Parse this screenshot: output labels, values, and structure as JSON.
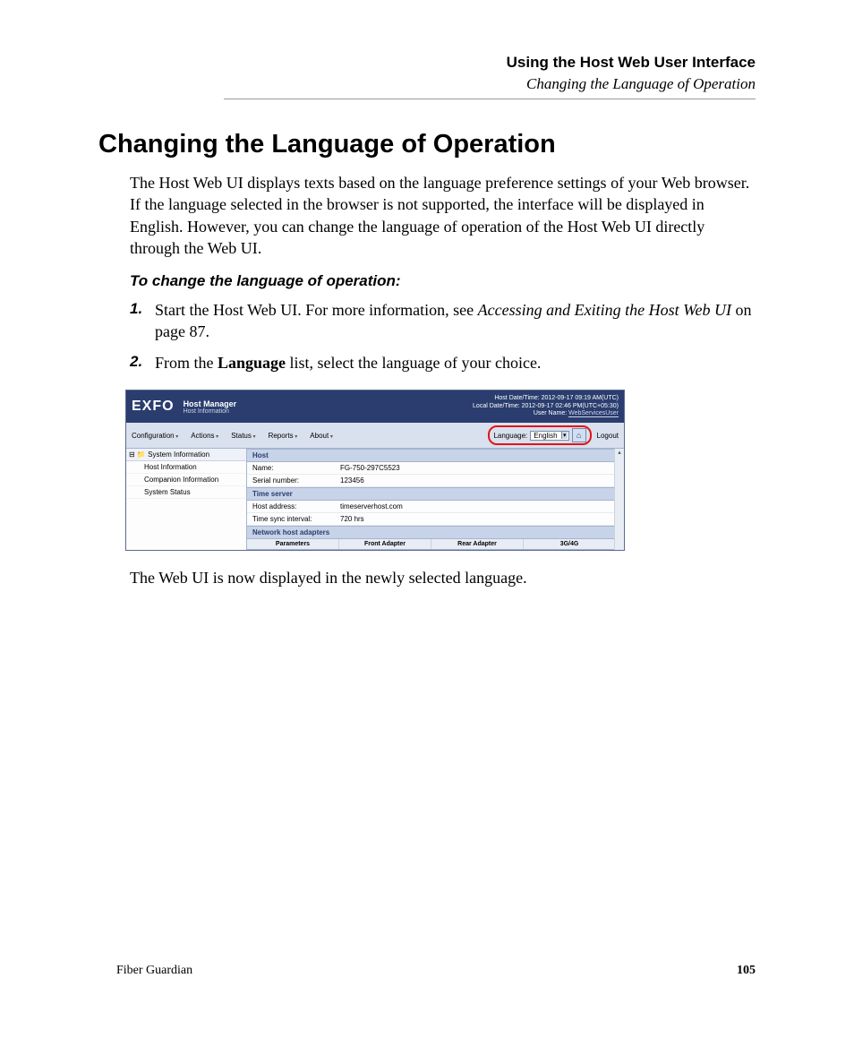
{
  "header": {
    "chapter": "Using the Host Web User Interface",
    "section": "Changing the Language of Operation"
  },
  "heading": "Changing the Language of Operation",
  "intro": "The Host Web UI displays texts based on the language preference settings of your Web browser. If the language selected in the browser is not supported, the interface will be displayed in English. However, you can change the language of operation of the Host Web UI directly through the Web UI.",
  "procedure_title": "To change the language of operation:",
  "steps": {
    "s1": {
      "num": "1.",
      "pre": "Start the Host Web UI. For more information, see ",
      "link": "Accessing and Exiting the Host Web UI",
      "post": " on page 87."
    },
    "s2": {
      "num": "2.",
      "pre": "From the ",
      "bold": "Language",
      "post": " list, select the language of your choice."
    }
  },
  "shot": {
    "logo": "EXFO",
    "title": "Host Manager",
    "subtitle": "Host Information",
    "host_datetime": "Host Date/Time: 2012-09-17 09:19 AM(UTC)",
    "local_datetime": "Local Date/Time: 2012-09-17 02:46 PM(UTC+05:30)",
    "user_label": "User Name: ",
    "user_name": "WebServicesUser",
    "menus": [
      "Configuration",
      "Actions",
      "Status",
      "Reports",
      "About"
    ],
    "language_label": "Language:",
    "language_value": "English",
    "logout": "Logout",
    "tree": {
      "root": "System Information",
      "items": [
        "Host Information",
        "Companion Information",
        "System Status"
      ]
    },
    "bands": {
      "host": "Host",
      "time": "Time server",
      "net": "Network host adapters"
    },
    "rows": {
      "name_k": "Name:",
      "name_v": "FG-750-297C5523",
      "serial_k": "Serial number:",
      "serial_v": "123456",
      "hostaddr_k": "Host address:",
      "hostaddr_v": "timeserverhost.com",
      "sync_k": "Time sync interval:",
      "sync_v": "720 hrs"
    },
    "cols": [
      "Parameters",
      "Front Adapter",
      "Rear Adapter",
      "3G/4G"
    ]
  },
  "after": "The Web UI is now displayed in the newly selected language.",
  "footer": {
    "product": "Fiber Guardian",
    "page": "105"
  }
}
